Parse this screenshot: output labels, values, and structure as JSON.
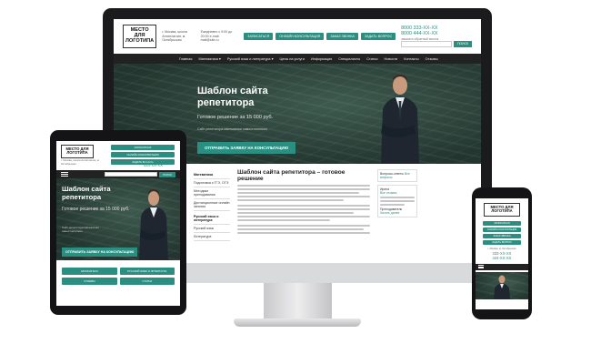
{
  "brand": {
    "logo_text": "МЕСТО ДЛЯ ЛОГОТИПА",
    "accent": "#2a8f80",
    "nav_bg": "#222222",
    "frame": "#1b1b1d"
  },
  "desktop": {
    "contacts_address": "г. Москва, школа Антиплагиат, м. Октябрьская",
    "contacts_hours": "Ежедневно с 9:00 до 20:00 e-mail: mail@site.ru",
    "buttons": [
      "ЗАПИСАТЬСЯ",
      "ОНЛАЙН КОНСУЛЬТАЦИЯ",
      "ЗАКАЗ ЗВОНКА",
      "ЗАДАТЬ ВОПРОС"
    ],
    "phone1": "8000 333-XX-XX",
    "phone2": "8000 444-XX-XX",
    "phone_caption": "заказать обратный звонок",
    "search_button": "ПОИСК",
    "nav": [
      "Главная",
      "Математика ▾",
      "Русский язык и литература ▾",
      "Цены на услуги",
      "Информация",
      "Специалисты",
      "Статьи",
      "Новости",
      "Контакты",
      "Отзывы"
    ],
    "hero_title": "Шаблон сайта репетитора",
    "hero_price": "Готовое решение за 15 000 руб.",
    "hero_sub": "Сайт репетитора математики самостоятельно",
    "hero_cta": "ОТПРАВИТЬ ЗАЯВКУ НА КОНСУЛЬТАЦИЮ",
    "sidebar": [
      "Математика",
      "Подготовка к ГГЭ, ОГЭ",
      "Методики преподавания",
      "Дистанционные онлайн занятия",
      "Русский язык и литература",
      "Русский язык",
      "Литература"
    ],
    "main_title": "Шаблон сайта репетитора – готовое решение",
    "aside": {
      "reviews_label": "Вопросы-ответы",
      "reviews_link": "Все вопросы",
      "teacher": "Ирина",
      "teacher_link": "Все отзывы",
      "note": "Преподаватель",
      "more": "Читать далее"
    }
  },
  "tablet": {
    "buttons": [
      "ЗАПИСАТЬСЯ",
      "ОНЛАЙН КОНСУЛЬТАЦИЯ",
      "ЗАДАТЬ ВОПРОС"
    ],
    "contact": "г. Москва, школа Антиплагиат, м. Октябрьская",
    "contact2": "Ежедневно e-mail",
    "phone1": "333-XX-XX",
    "phone2": "444-XX-XX",
    "search_button": "ПОИСК",
    "hero_title": "Шаблон сайта репетитора",
    "hero_price": "Готовое решение за 15 000 руб.",
    "hero_sub": "Сайт репетитора математики самостоятельно",
    "hero_cta": "ОТПРАВИТЬ ЗАЯВКУ НА КОНСУЛЬТАЦИЮ",
    "grid": [
      "ЗАПИСАТЬСЯ",
      "РУССКИЙ ЯЗЫК И ЛИТЕРАТУРА",
      "ОТЗЫВЫ",
      "СТАТЬИ"
    ]
  },
  "phone": {
    "buttons": [
      "ЗАПИСАТЬСЯ",
      "ОНЛАЙН КОНСУЛЬТАЦИЯ",
      "ЗАКАЗ ЗВОНКА",
      "ЗАДАТЬ ВОПРОС"
    ],
    "text": "г. Москва, м. Октябрьская",
    "phone1": "333-XX-XX",
    "phone2": "444-XX-XX"
  }
}
